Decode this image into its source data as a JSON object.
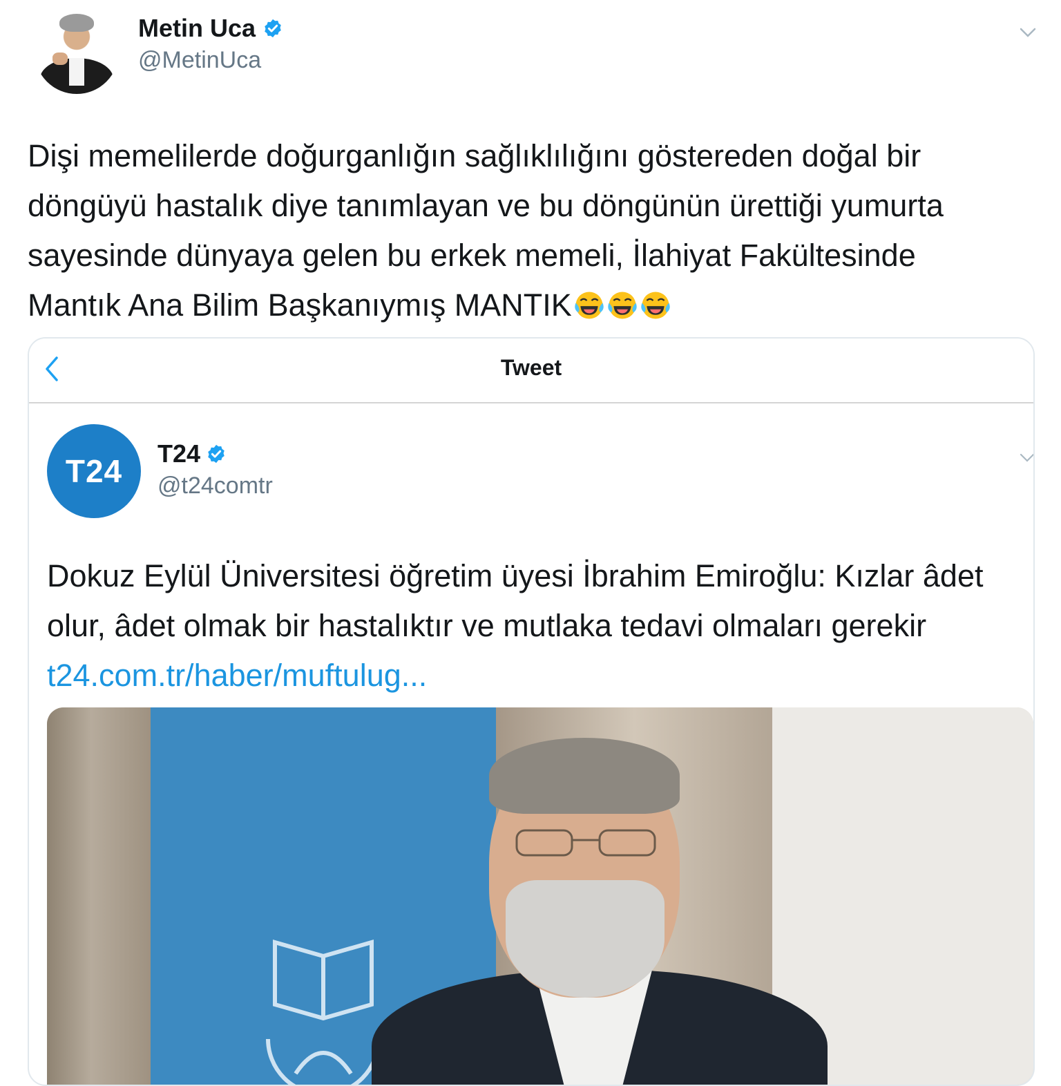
{
  "author": {
    "name": "Metin Uca",
    "handle": "@MetinUca"
  },
  "tweet": {
    "text": "Dişi memelilerde doğurganlığın sağlıklılığını göstereden doğal bir\ndöngüyü hastalık diye tanımlayan ve bu döngünün ürettiği yumurta\nsayesinde dünyaya gelen bu erkek memeli, İlahiyat Fakültesinde\nMantık Ana Bilim Başkanıymış MANTIK",
    "emojis": [
      "face-with-tears-of-joy-icon",
      "face-with-tears-of-joy-icon",
      "face-with-tears-of-joy-icon"
    ]
  },
  "quote_card": {
    "header_title": "Tweet",
    "author": {
      "avatar_text": "T24",
      "name": "T24",
      "handle": "@t24comtr"
    },
    "text": "Dokuz Eylül Üniversitesi öğretim üyesi İbrahim Emiroğlu: Kızlar âdet olur, âdet olmak bir hastalıktır ve mutlaka tedavi olmaları gerekir",
    "link": "t24.com.tr/haber/muftulug..."
  },
  "colors": {
    "text": "#14171a",
    "secondary": "#657786",
    "link": "#1b95e0",
    "verified": "#1da1f2",
    "t24_brand": "#1d7fc8"
  }
}
